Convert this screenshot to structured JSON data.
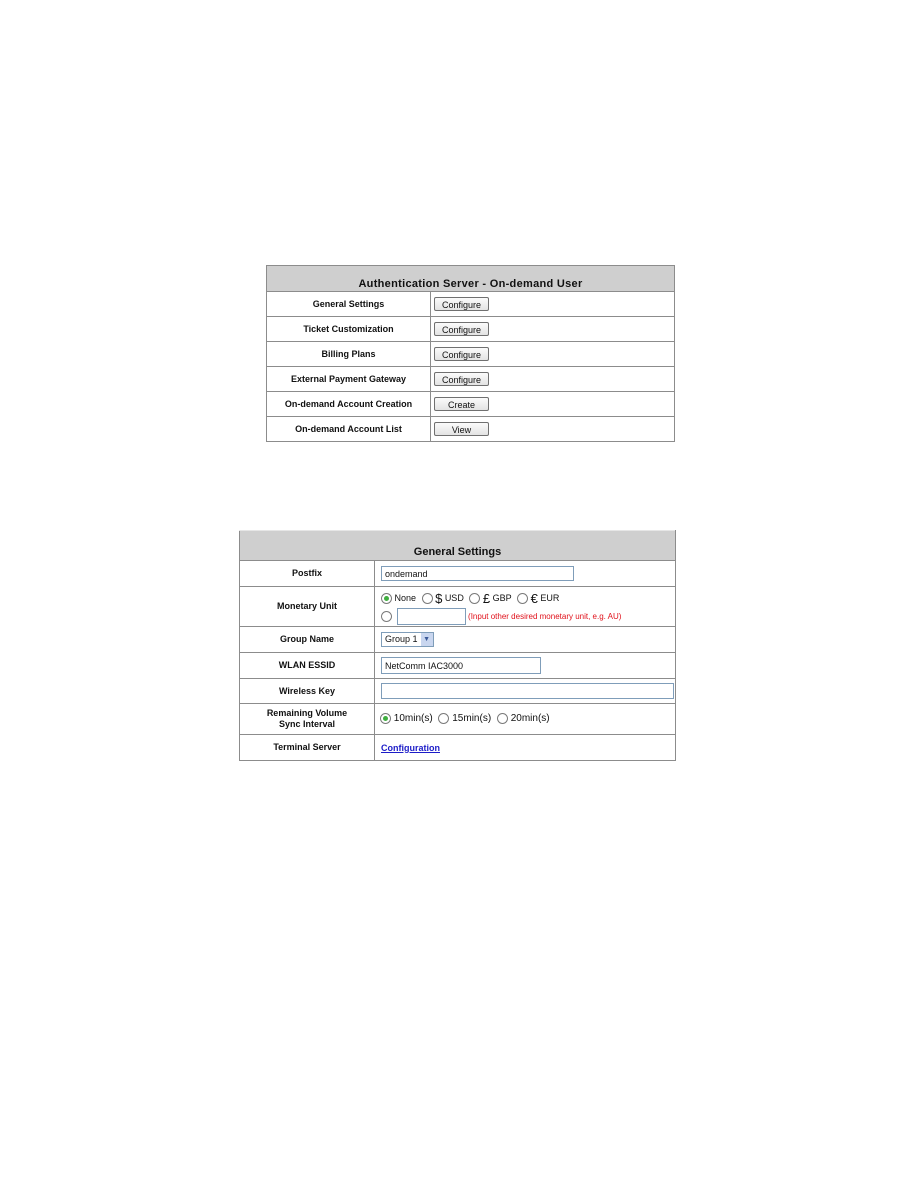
{
  "auth_table": {
    "title": "Authentication Server - On-demand User",
    "rows": [
      {
        "label": "General Settings",
        "button": "Configure"
      },
      {
        "label": "Ticket Customization",
        "button": "Configure"
      },
      {
        "label": "Billing Plans",
        "button": "Configure"
      },
      {
        "label": "External Payment Gateway",
        "button": "Configure"
      },
      {
        "label": "On-demand Account Creation",
        "button": "Create"
      },
      {
        "label": "On-demand Account List",
        "button": "View"
      }
    ]
  },
  "general_settings": {
    "title": "General Settings",
    "postfix": {
      "label": "Postfix",
      "value": "ondemand"
    },
    "monetary_unit": {
      "label": "Monetary Unit",
      "options": [
        {
          "symbol": "",
          "text": "None",
          "selected": true
        },
        {
          "symbol": "$",
          "text": "USD",
          "selected": false
        },
        {
          "symbol": "£",
          "text": "GBP",
          "selected": false
        },
        {
          "symbol": "€",
          "text": "EUR",
          "selected": false
        }
      ],
      "other_value": "",
      "other_hint": "(Input other desired monetary unit, e.g. AU)"
    },
    "group_name": {
      "label": "Group Name",
      "selected": "Group 1"
    },
    "wlan_essid": {
      "label": "WLAN ESSID",
      "value": "NetComm IAC3000"
    },
    "wireless_key": {
      "label": "Wireless Key",
      "value": ""
    },
    "sync_interval": {
      "label_line1": "Remaining Volume",
      "label_line2": "Sync Interval",
      "options": [
        {
          "text": "10min(s)",
          "selected": true
        },
        {
          "text": "15min(s)",
          "selected": false
        },
        {
          "text": "20min(s)",
          "selected": false
        }
      ]
    },
    "terminal_server": {
      "label": "Terminal Server",
      "link": "Configuration"
    }
  }
}
